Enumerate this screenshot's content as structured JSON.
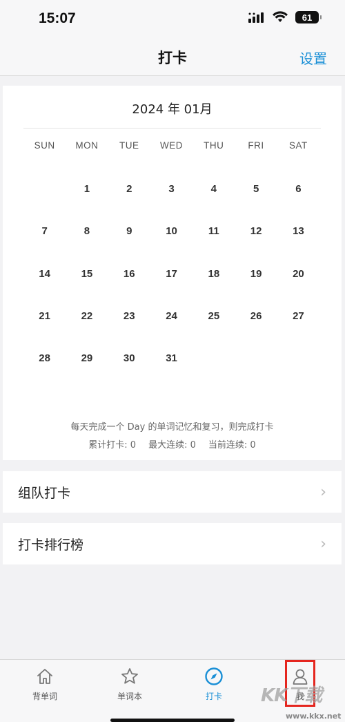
{
  "status_bar": {
    "time": "15:07",
    "battery": "61",
    "icons": [
      "signal-icon",
      "wifi-icon",
      "battery-icon"
    ]
  },
  "nav": {
    "title": "打卡",
    "settings_label": "设置"
  },
  "calendar": {
    "month_title": "2024 年 01月",
    "weekdays": [
      "SUN",
      "MON",
      "TUE",
      "WED",
      "THU",
      "FRI",
      "SAT"
    ],
    "first_weekday_index": 1,
    "days": [
      "1",
      "2",
      "3",
      "4",
      "5",
      "6",
      "7",
      "8",
      "9",
      "10",
      "11",
      "12",
      "13",
      "14",
      "15",
      "16",
      "17",
      "18",
      "19",
      "20",
      "21",
      "22",
      "23",
      "24",
      "25",
      "26",
      "27",
      "28",
      "29",
      "30",
      "31"
    ],
    "note": "每天完成一个 Day 的单词记忆和复习，则完成打卡",
    "stats": {
      "total_label": "累计打卡: 0",
      "max_label": "最大连续: 0",
      "current_label": "当前连续: 0"
    }
  },
  "list": {
    "team_checkin": "组队打卡",
    "leaderboard": "打卡排行榜"
  },
  "tab_bar": {
    "tabs": [
      {
        "label": "背单词",
        "icon": "home-icon",
        "active": false
      },
      {
        "label": "单词本",
        "icon": "star-icon",
        "active": false
      },
      {
        "label": "打卡",
        "icon": "compass-icon",
        "active": true
      },
      {
        "label": "我",
        "icon": "person-icon",
        "active": false
      }
    ]
  },
  "watermark": {
    "text": "KK下载",
    "url": "www.kkx.net"
  },
  "colors": {
    "accent": "#1a8fd6",
    "highlight": "#e5261f",
    "background": "#f2f2f4"
  }
}
